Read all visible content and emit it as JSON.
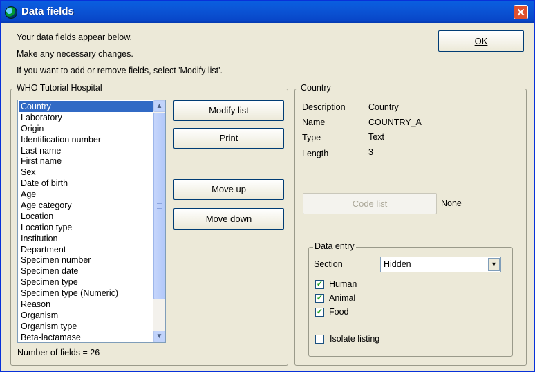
{
  "window": {
    "title": "Data fields",
    "close_glyph": "✕"
  },
  "intro": {
    "line1": "Your data fields appear below.",
    "line2": "Make any necessary changes.",
    "line3": "If you want to add or remove fields, select 'Modify list'."
  },
  "ok_label": "OK",
  "left_group": {
    "legend": "WHO Tutorial Hospital",
    "fields": [
      "Country",
      "Laboratory",
      "Origin",
      "Identification number",
      "Last name",
      "First name",
      "Sex",
      "Date of birth",
      "Age",
      "Age category",
      "Location",
      "Location type",
      "Institution",
      "Department",
      "Specimen number",
      "Specimen date",
      "Specimen type",
      "Specimen type (Numeric)",
      "Reason",
      "Organism",
      "Organism type",
      "Beta-lactamase"
    ],
    "selected": "Country",
    "count_text": "Number of fields = 26",
    "buttons": {
      "modify": "Modify list",
      "print": "Print",
      "move_up": "Move up",
      "move_down": "Move down"
    }
  },
  "right_group": {
    "legend": "Country",
    "props": {
      "description_label": "Description",
      "description_value": "Country",
      "name_label": "Name",
      "name_value": "COUNTRY_A",
      "type_label": "Type",
      "type_value": "Text",
      "length_label": "Length",
      "length_value": "3"
    },
    "code_list_label": "Code list",
    "code_list_value": "None",
    "data_entry": {
      "legend": "Data entry",
      "section_label": "Section",
      "section_value": "Hidden",
      "human": "Human",
      "human_checked": true,
      "animal": "Animal",
      "animal_checked": true,
      "food": "Food",
      "food_checked": true,
      "isolate": "Isolate listing",
      "isolate_checked": false
    }
  },
  "icons": {
    "app": "globe-icon",
    "close": "close-icon",
    "scroll_up": "chevron-up-icon",
    "scroll_down": "chevron-down-icon",
    "dropdown": "chevron-down-icon",
    "check": "checkmark-icon"
  },
  "colors": {
    "titlebar": "#0a5fe0",
    "selection": "#316ac5",
    "close": "#e0502f",
    "face": "#ece9d8"
  }
}
